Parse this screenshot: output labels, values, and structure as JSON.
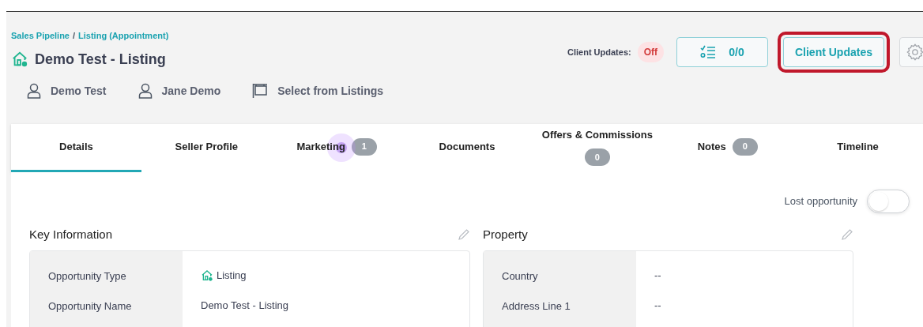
{
  "breadcrumb": [
    "Sales Pipeline",
    "Listing (Appointment)"
  ],
  "breadcrumb_separator": "/",
  "title": "Demo Test - Listing",
  "contacts": [
    {
      "kind": "person",
      "label": "Demo Test"
    },
    {
      "kind": "person",
      "label": "Jane Demo"
    },
    {
      "kind": "listing",
      "label": "Select from Listings"
    }
  ],
  "client_updates": {
    "label": "Client Updates:",
    "status": "Off",
    "on": false
  },
  "tasks_button": {
    "label": "0/0"
  },
  "client_updates_button": {
    "label": "Client Updates",
    "highlighted": true
  },
  "tabs": [
    {
      "label": "Details",
      "selected": true
    },
    {
      "label": "Seller Profile",
      "selected": false
    },
    {
      "label": "Marketing",
      "badge": "1",
      "selected": false,
      "clicked": true
    },
    {
      "label": "Documents",
      "selected": false
    },
    {
      "label": "Offers & Commissions",
      "badge": "0",
      "selected": false,
      "stacked": true
    },
    {
      "label": "Notes",
      "badge": "0",
      "selected": false
    },
    {
      "label": "Timeline",
      "selected": false
    }
  ],
  "lost_opportunity": {
    "label": "Lost opportunity",
    "on": false
  },
  "sections": [
    {
      "title": "Key Information",
      "rows": [
        {
          "label": "Opportunity Type",
          "value": "Listing",
          "icon": true
        },
        {
          "label": "Opportunity Name",
          "value": "Demo Test - Listing"
        }
      ]
    },
    {
      "title": "Property",
      "rows": [
        {
          "label": "Country",
          "value": "--"
        },
        {
          "label": "Address Line 1",
          "value": "--"
        }
      ]
    }
  ]
}
